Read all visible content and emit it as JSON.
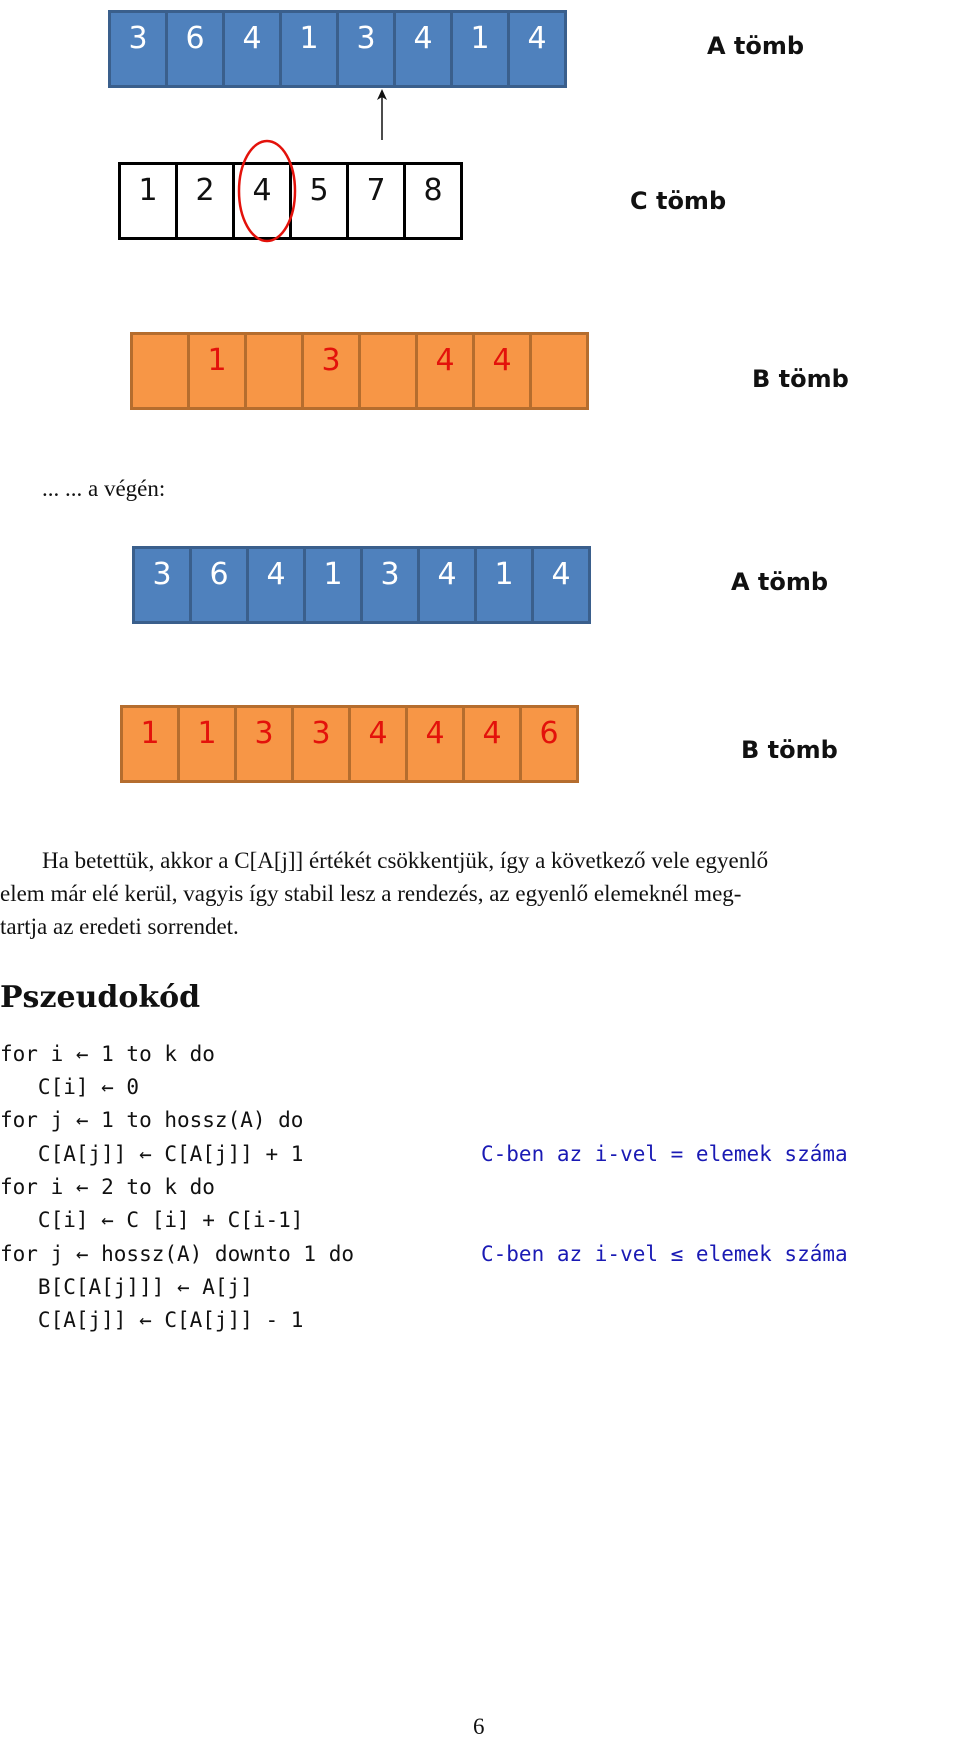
{
  "figure1": {
    "array_a": {
      "label": "A tömb",
      "values": [
        "3",
        "6",
        "4",
        "1",
        "3",
        "4",
        "1",
        "4"
      ],
      "pointer_index": 4
    },
    "array_c": {
      "label": "C tömb",
      "values": [
        "1",
        "2",
        "4",
        "5",
        "7",
        "8"
      ],
      "highlighted_index": 2
    },
    "array_b": {
      "label": "B tömb",
      "values": [
        "",
        "1",
        "",
        "3",
        "",
        "4",
        "4",
        ""
      ]
    }
  },
  "interlude": "... ... a végén:",
  "figure2": {
    "array_a": {
      "label": "A tömb",
      "values": [
        "3",
        "6",
        "4",
        "1",
        "3",
        "4",
        "1",
        "4"
      ]
    },
    "array_b": {
      "label": "B tömb",
      "values": [
        "1",
        "1",
        "3",
        "3",
        "4",
        "4",
        "4",
        "6"
      ]
    }
  },
  "paragraph": {
    "lines": [
      "Ha betettük, akkor a C[A[j]] értékét csökkentjük, így a következő vele egyenlő",
      "elem már elé kerül, vagyis így stabil lesz a rendezés, az egyenlő elemeknél meg-",
      "tartja az eredeti sorrendet."
    ]
  },
  "section_title": "Pszeudokód",
  "pseudocode": {
    "lines": [
      {
        "code": "for i ← 1 to k do",
        "comment": ""
      },
      {
        "code": "   C[i] ← 0",
        "comment": ""
      },
      {
        "code": "for j ← 1 to hossz(A) do",
        "comment": ""
      },
      {
        "code": "   C[A[j]] ← C[A[j]] + 1",
        "comment": "C-ben az i-vel = elemek száma"
      },
      {
        "code": "for i ← 2 to k do",
        "comment": ""
      },
      {
        "code": "   C[i] ← C [i] + C[i-1]",
        "comment": ""
      },
      {
        "code": "for j ← hossz(A) downto 1 do",
        "comment": "C-ben az i-vel ≤ elemek száma"
      },
      {
        "code": "   B[C[A[j]]] ← A[j]",
        "comment": ""
      },
      {
        "code": "   C[A[j]] ← C[A[j]] - 1",
        "comment": ""
      }
    ]
  },
  "page_number": "6",
  "colors": {
    "array_a": "#4F81BD",
    "array_b": "#F79646",
    "b_text": "#E3120B",
    "highlight": "#E3120B",
    "comment": "#1a1ab4"
  }
}
